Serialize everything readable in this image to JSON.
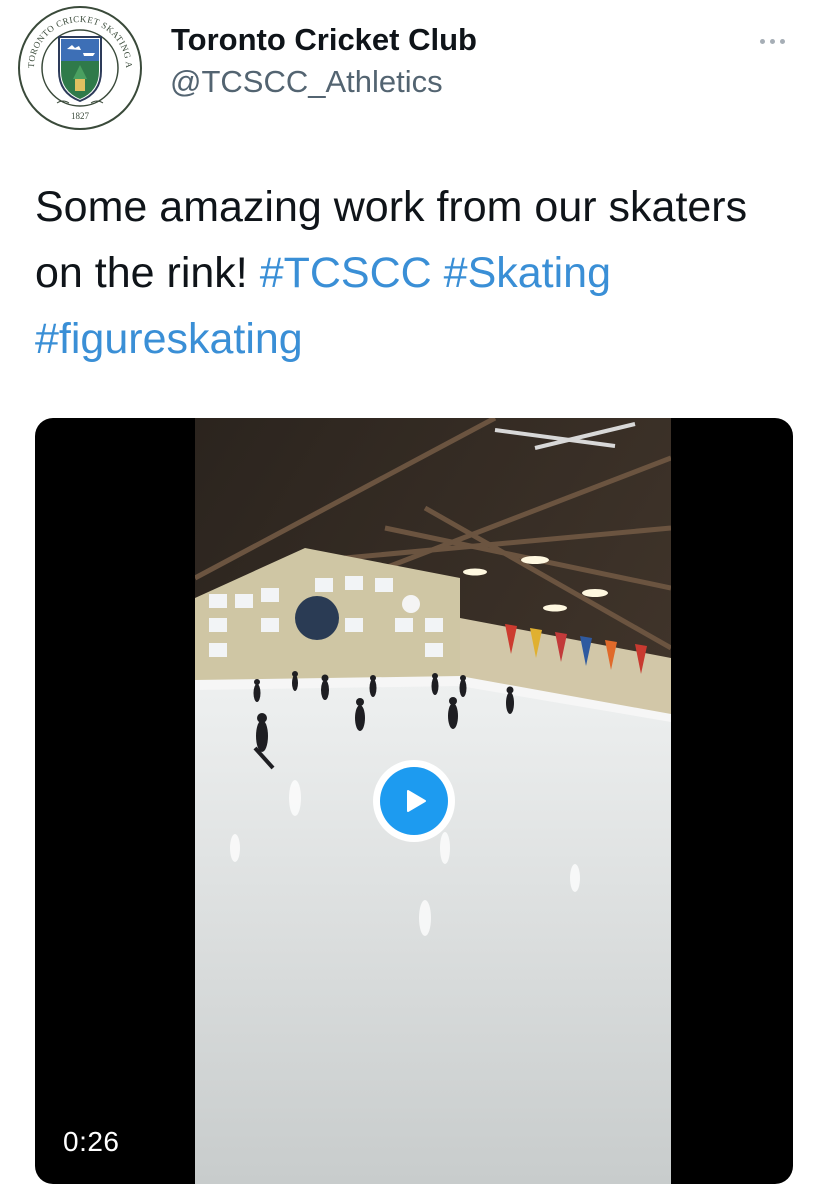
{
  "tweet": {
    "author": {
      "display_name": "Toronto Cricket Club",
      "handle": "@TCSCC_Athletics",
      "avatar": {
        "icon": "club-crest-icon",
        "ring_text": "TORONTO CRICKET SKATING AND CURLING CLUB",
        "year": "1827"
      }
    },
    "more_icon": "more-options-icon",
    "text": {
      "plain": "Some amazing work from our skaters on the rink! ",
      "hashtags": [
        "#TCSCC",
        "#Skating",
        "#figureskating"
      ]
    },
    "media": {
      "type": "video",
      "duration": "0:26",
      "play_icon": "play-icon"
    }
  },
  "colors": {
    "hashtag": "#3a8fd6",
    "play_button": "#1d9bf0",
    "handle": "#536471"
  }
}
